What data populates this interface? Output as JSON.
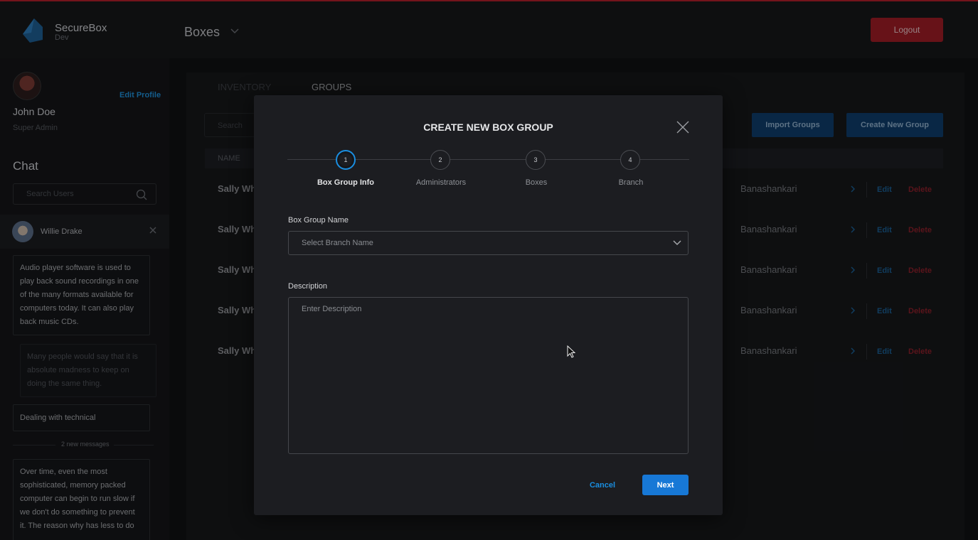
{
  "app": {
    "brand_name": "SecureBox",
    "brand_env": "Dev",
    "section_title": "Boxes",
    "logout_label": "Logout"
  },
  "profile": {
    "name": "John Doe",
    "role": "Super Admin",
    "edit_label": "Edit Profile"
  },
  "chat": {
    "title": "Chat",
    "search_placeholder": "Search Users",
    "contact_name": "Willie Drake",
    "messages": [
      "Audio player software is used to play back sound recordings in one of the many formats available for computers today. It can also play back music CDs.",
      "Many people would say that it is absolute madness to keep on doing the same thing.",
      "Dealing with technical",
      "Over time, even the most sophisticated, memory packed computer can begin to run slow if we don't do something to prevent it. The reason why has less to do"
    ],
    "new_messages_label": "2 new messages"
  },
  "main": {
    "tabs": [
      "INVENTORY",
      "GROUPS"
    ],
    "active_tab": "GROUPS",
    "search_placeholder": "Search",
    "import_label": "Import Groups",
    "create_label": "Create New Group",
    "name_header": "NAME",
    "rows": [
      {
        "name": "Sally Wh",
        "branch": "Banashankari",
        "edit": "Edit",
        "delete": "Delete"
      },
      {
        "name": "Sally Wh",
        "branch": "Banashankari",
        "edit": "Edit",
        "delete": "Delete"
      },
      {
        "name": "Sally Wh",
        "branch": "Banashankari",
        "edit": "Edit",
        "delete": "Delete"
      },
      {
        "name": "Sally Wh",
        "branch": "Banashankari",
        "edit": "Edit",
        "delete": "Delete"
      },
      {
        "name": "Sally Wh",
        "branch": "Banashankari",
        "edit": "Edit",
        "delete": "Delete"
      }
    ]
  },
  "modal": {
    "title": "CREATE NEW BOX GROUP",
    "steps": [
      {
        "number": "1",
        "label": "Box Group Info"
      },
      {
        "number": "2",
        "label": "Administrators"
      },
      {
        "number": "3",
        "label": "Boxes"
      },
      {
        "number": "4",
        "label": "Branch"
      }
    ],
    "active_step": 1,
    "group_name_label": "Box Group Name",
    "group_name_placeholder": "Select Branch Name",
    "description_label": "Description",
    "description_placeholder": "Enter Description",
    "cancel_label": "Cancel",
    "next_label": "Next"
  },
  "colors": {
    "accent": "#1778d6",
    "danger": "#9e1c26",
    "link": "#1a8ee0"
  }
}
